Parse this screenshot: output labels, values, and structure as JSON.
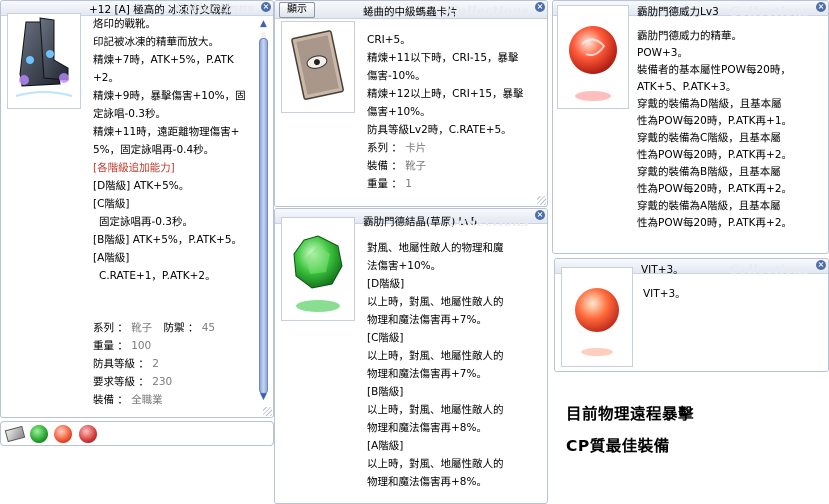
{
  "win1": {
    "title": "+12 [A] 極高的 冰凍符文戰靴",
    "watermark": "Collections",
    "lines": [
      "烙印的戰靴。",
      "印記被冰凍的精華而放大。",
      "精煉+7時，ATK+5%，P.ATK",
      "+2。",
      "精煉+9時，暴擊傷害+10%，固",
      "定詠唱-0.3秒。",
      "精煉+11時，遠距離物理傷害+",
      "5%，固定詠唱再-0.4秒。",
      "[各階級追加能力]",
      "[D階級] ATK+5%。",
      "[C階級]",
      " 固定詠唱再-0.3秒。",
      "[B階級] ATK+5%，P.ATK+5。",
      "[A階級]",
      " C.RATE+1，P.ATK+2。"
    ],
    "stats": [
      {
        "label": "系列 ：",
        "value": "靴子",
        "extra_label": "防禦 ：",
        "extra_value": "45"
      },
      {
        "label": "重量 ：",
        "value": "100"
      },
      {
        "label": "防具等級 ：",
        "value": "2"
      },
      {
        "label": "要求等級 ：",
        "value": "230"
      },
      {
        "label": "裝備 ：",
        "value": "全職業"
      }
    ]
  },
  "win2": {
    "button": "顯示",
    "title": "蜷曲的中級螞蟲卡片",
    "watermark": "Collections",
    "lines": [
      "CRI+5。",
      "精煉+11以下時，CRI-15，暴擊",
      "傷害-10%。",
      "精煉+12以上時，CRI+15，暴擊",
      "傷害+10%。",
      "防具等級Lv2時，C.RATE+5。"
    ],
    "stats": [
      {
        "label": "系列 ：",
        "value": "卡片"
      },
      {
        "label": "裝備 ：",
        "value": "靴子"
      },
      {
        "label": "重量 ：",
        "value": "1"
      }
    ]
  },
  "win3": {
    "title": "霸肋門德結晶(草原) Lv5",
    "watermark": "Collections",
    "lines": [
      "對風、地屬性敵人的物理和魔",
      "法傷害+10%。",
      "[D階級]",
      "以上時，對風、地屬性敵人的",
      "物理和魔法傷害再+7%。",
      "[C階級]",
      "以上時，對風、地屬性敵人的",
      "物理和魔法傷害再+7%。",
      "[B階級]",
      "以上時，對風、地屬性敵人的",
      "物理和魔法傷害再+8%。",
      "[A階級]",
      "以上時，對風、地屬性敵人的",
      "物理和魔法傷害再+8%。"
    ]
  },
  "win4": {
    "title": "霸肋門德威力Lv3",
    "watermark": "Collections",
    "lines": [
      "霸肋門德威力的精華。",
      "POW+3。",
      "裝備者的基本屬性POW每20時，",
      "ATK+5、P.ATK+3。",
      "穿戴的裝備為D階級，且基本屬",
      "性為POW每20時，P.ATK再+1。",
      "穿戴的裝備為C階級，且基本屬",
      "性為POW每20時，P.ATK再+2。",
      "穿戴的裝備為B階級，且基本屬",
      "性為POW每20時，P.ATK再+2。",
      "穿戴的裝備為A階級，且基本屬",
      "性為POW每20時，P.ATK再+2。"
    ]
  },
  "win5": {
    "title": "VIT+3。",
    "watermark": "Collections",
    "lines": [
      "VIT+3。"
    ]
  },
  "caption": {
    "line1": "目前物理遠程暴擊",
    "line2": "CP質最佳裝備"
  },
  "colors": {
    "border": "#b9c3d3",
    "scrollbar": "#8fa6d8",
    "section_red": "#c0392b",
    "value_gray": "#7a7a7a"
  }
}
